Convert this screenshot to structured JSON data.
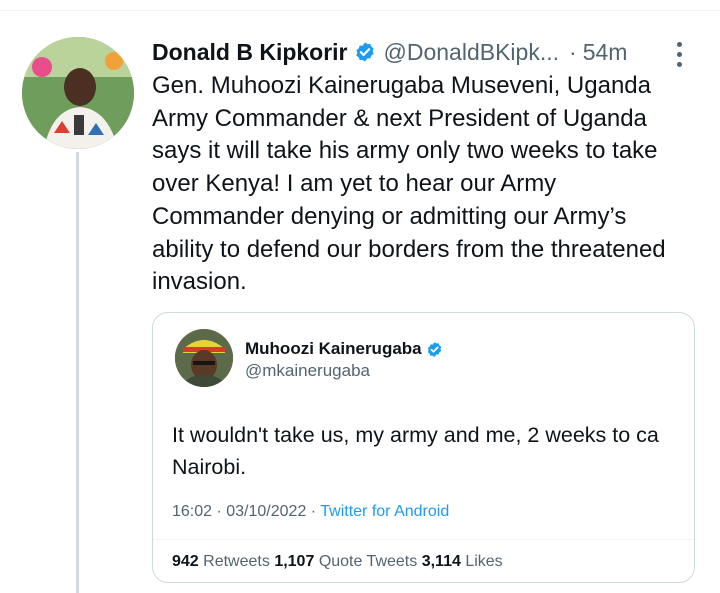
{
  "tweet": {
    "display_name": "Donald B Kipkorir",
    "handle": "@DonaldBKipk...",
    "separator": "·",
    "time": "54m",
    "text_lines": [
      "Gen. Muhoozi Kainerugaba Museveni, Uganda",
      "Army Commander & next President of Uganda",
      "says it will take his army only two weeks to take",
      "over Kenya! I am yet to hear our Army",
      "Commander denying or admitting our Army’s",
      "ability to defend our borders from the threatened",
      "invasion."
    ],
    "icons": {
      "verified": "verified-badge-icon",
      "more": "more-options-icon"
    },
    "accent_color": "#1d9bf0"
  },
  "quote": {
    "display_name": "Muhoozi Kainerugaba",
    "handle": "@mkainerugaba",
    "text_lines": [
      "It wouldn't take us, my army and me, 2 weeks to ca",
      "Nairobi."
    ],
    "timestamp": "16:02 · 03/10/2022 ·",
    "source": "Twitter for Android",
    "stats": {
      "retweets_count": "942",
      "retweets_label": "Retweets",
      "quote_tweets_count": "1,107",
      "quote_tweets_label": "Quote Tweets",
      "likes_count": "3,114",
      "likes_label": "Likes"
    }
  }
}
